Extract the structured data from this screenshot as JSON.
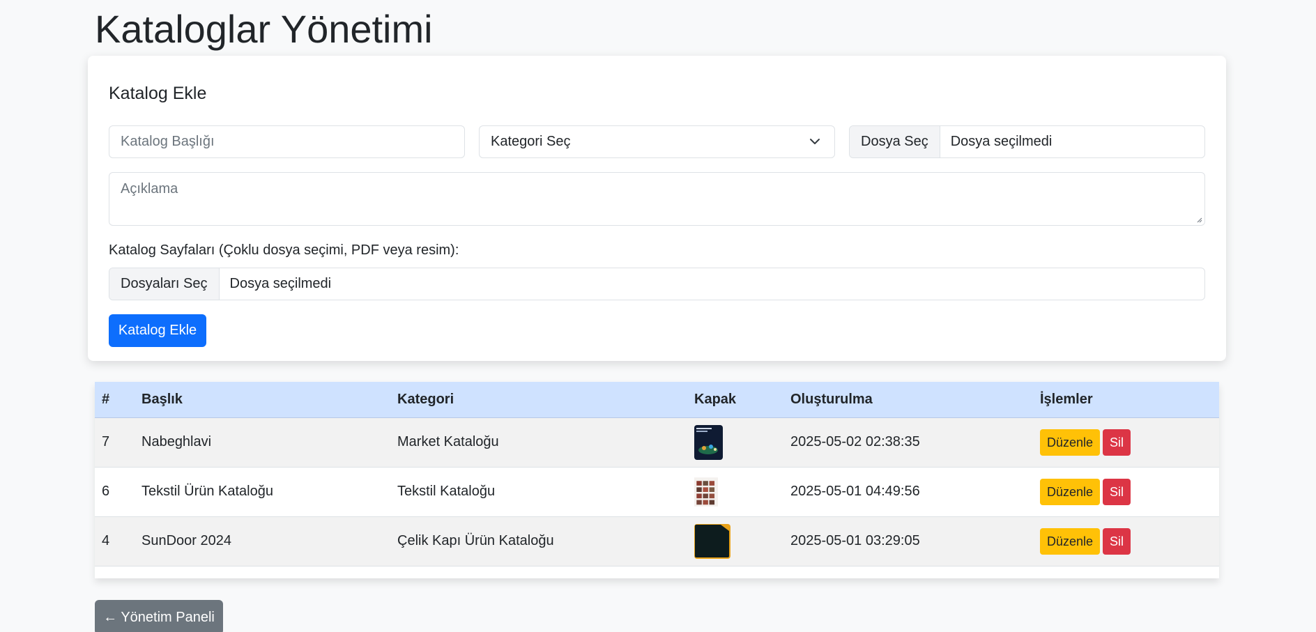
{
  "page": {
    "title": "Kataloglar Yönetimi"
  },
  "form": {
    "title": "Katalog Ekle",
    "catalog_title_placeholder": "Katalog Başlığı",
    "category_select_value": "Kategori Seç",
    "file_button": "Dosya Seç",
    "file_status": "Dosya seçilmedi",
    "description_placeholder": "Açıklama",
    "pages_label": "Katalog Sayfaları (Çoklu dosya seçimi, PDF veya resim):",
    "pages_button": "Dosyaları Seç",
    "pages_status": "Dosya seçilmedi",
    "submit_label": "Katalog Ekle"
  },
  "table": {
    "headers": [
      "#",
      "Başlık",
      "Kategori",
      "Kapak",
      "Oluşturulma",
      "İşlemler"
    ],
    "rows": [
      {
        "id": "7",
        "title": "Nabeghlavi",
        "category": "Market Kataloğu",
        "cover": "market-cover",
        "created": "2025-05-02 02:38:35",
        "edit": "Düzenle",
        "delete": "Sil"
      },
      {
        "id": "6",
        "title": "Tekstil Ürün Kataloğu",
        "category": "Tekstil Kataloğu",
        "cover": "textile-cover",
        "created": "2025-05-01 04:49:56",
        "edit": "Düzenle",
        "delete": "Sil"
      },
      {
        "id": "4",
        "title": "SunDoor 2024",
        "category": "Çelik Kapı Ürün Kataloğu",
        "cover": "door-cover",
        "created": "2025-05-01 03:29:05",
        "edit": "Düzenle",
        "delete": "Sil"
      }
    ]
  },
  "nav": {
    "back_label": "← Yönetim Paneli"
  },
  "colors": {
    "primary": "#0d6efd",
    "warning": "#ffc107",
    "danger": "#dc3545",
    "secondary": "#6c757d",
    "table_header": "#cfe2ff"
  }
}
